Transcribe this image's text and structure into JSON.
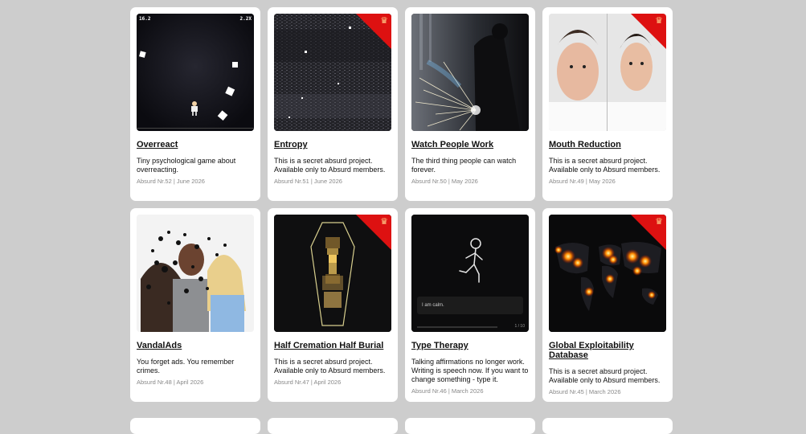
{
  "cards": [
    {
      "title": "Overreact",
      "desc": "Tiny psychological game about overreacting.",
      "meta": "Absurd Nr.52 | June 2026",
      "premium": false,
      "hud_left": "16.2",
      "hud_right": "2.2X"
    },
    {
      "title": "Entropy",
      "desc": "This is a secret absurd project. Available only to Absurd members.",
      "meta": "Absurd Nr.51 | June 2026",
      "premium": true
    },
    {
      "title": "Watch People Work",
      "desc": "The third thing people can watch forever.",
      "meta": "Absurd Nr.50 | May 2026",
      "premium": false
    },
    {
      "title": "Mouth Reduction",
      "desc": "This is a secret absurd project. Available only to Absurd members.",
      "meta": "Absurd Nr.49 | May 2026",
      "premium": true
    },
    {
      "title": "VandalAds",
      "desc": "You forget ads. You remember crimes.",
      "meta": "Absurd Nr.48 | April 2026",
      "premium": false
    },
    {
      "title": "Half Cremation Half Burial",
      "desc": "This is a secret absurd project. Available only to Absurd members.",
      "meta": "Absurd Nr.47 | April 2026",
      "premium": true
    },
    {
      "title": "Type Therapy",
      "desc": "Talking affirmations no longer work. Writing is speech now. If you want to change something - type it.",
      "meta": "Absurd Nr.46 | March 2026",
      "premium": false,
      "input_text": "I am calm.",
      "counter": "1 / 10"
    },
    {
      "title": "Global Exploitability Database",
      "desc": "This is a secret absurd project. Available only to Absurd members.",
      "meta": "Absurd Nr.45 | March 2026",
      "premium": true
    }
  ],
  "colors": {
    "background": "#cdcdcd",
    "card": "#ffffff",
    "premium_corner": "#dd1111"
  },
  "icons": {
    "premium": "crown-icon"
  }
}
